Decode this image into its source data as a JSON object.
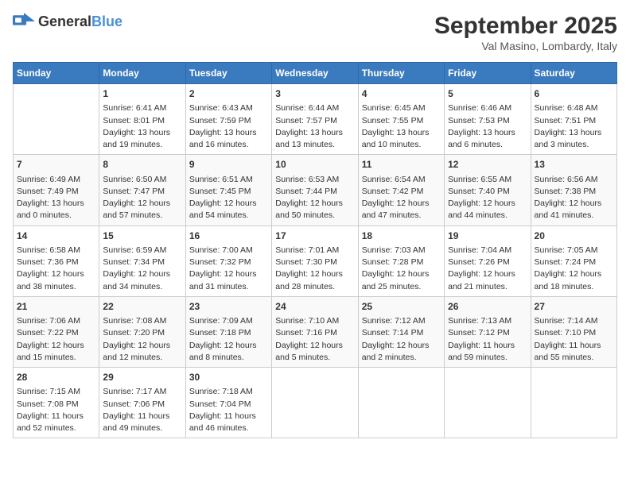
{
  "header": {
    "logo_general": "General",
    "logo_blue": "Blue",
    "title": "September 2025",
    "subtitle": "Val Masino, Lombardy, Italy"
  },
  "days_of_week": [
    "Sunday",
    "Monday",
    "Tuesday",
    "Wednesday",
    "Thursday",
    "Friday",
    "Saturday"
  ],
  "weeks": [
    [
      {
        "day": "",
        "info": ""
      },
      {
        "day": "1",
        "info": "Sunrise: 6:41 AM\nSunset: 8:01 PM\nDaylight: 13 hours\nand 19 minutes."
      },
      {
        "day": "2",
        "info": "Sunrise: 6:43 AM\nSunset: 7:59 PM\nDaylight: 13 hours\nand 16 minutes."
      },
      {
        "day": "3",
        "info": "Sunrise: 6:44 AM\nSunset: 7:57 PM\nDaylight: 13 hours\nand 13 minutes."
      },
      {
        "day": "4",
        "info": "Sunrise: 6:45 AM\nSunset: 7:55 PM\nDaylight: 13 hours\nand 10 minutes."
      },
      {
        "day": "5",
        "info": "Sunrise: 6:46 AM\nSunset: 7:53 PM\nDaylight: 13 hours\nand 6 minutes."
      },
      {
        "day": "6",
        "info": "Sunrise: 6:48 AM\nSunset: 7:51 PM\nDaylight: 13 hours\nand 3 minutes."
      }
    ],
    [
      {
        "day": "7",
        "info": "Sunrise: 6:49 AM\nSunset: 7:49 PM\nDaylight: 13 hours\nand 0 minutes."
      },
      {
        "day": "8",
        "info": "Sunrise: 6:50 AM\nSunset: 7:47 PM\nDaylight: 12 hours\nand 57 minutes."
      },
      {
        "day": "9",
        "info": "Sunrise: 6:51 AM\nSunset: 7:45 PM\nDaylight: 12 hours\nand 54 minutes."
      },
      {
        "day": "10",
        "info": "Sunrise: 6:53 AM\nSunset: 7:44 PM\nDaylight: 12 hours\nand 50 minutes."
      },
      {
        "day": "11",
        "info": "Sunrise: 6:54 AM\nSunset: 7:42 PM\nDaylight: 12 hours\nand 47 minutes."
      },
      {
        "day": "12",
        "info": "Sunrise: 6:55 AM\nSunset: 7:40 PM\nDaylight: 12 hours\nand 44 minutes."
      },
      {
        "day": "13",
        "info": "Sunrise: 6:56 AM\nSunset: 7:38 PM\nDaylight: 12 hours\nand 41 minutes."
      }
    ],
    [
      {
        "day": "14",
        "info": "Sunrise: 6:58 AM\nSunset: 7:36 PM\nDaylight: 12 hours\nand 38 minutes."
      },
      {
        "day": "15",
        "info": "Sunrise: 6:59 AM\nSunset: 7:34 PM\nDaylight: 12 hours\nand 34 minutes."
      },
      {
        "day": "16",
        "info": "Sunrise: 7:00 AM\nSunset: 7:32 PM\nDaylight: 12 hours\nand 31 minutes."
      },
      {
        "day": "17",
        "info": "Sunrise: 7:01 AM\nSunset: 7:30 PM\nDaylight: 12 hours\nand 28 minutes."
      },
      {
        "day": "18",
        "info": "Sunrise: 7:03 AM\nSunset: 7:28 PM\nDaylight: 12 hours\nand 25 minutes."
      },
      {
        "day": "19",
        "info": "Sunrise: 7:04 AM\nSunset: 7:26 PM\nDaylight: 12 hours\nand 21 minutes."
      },
      {
        "day": "20",
        "info": "Sunrise: 7:05 AM\nSunset: 7:24 PM\nDaylight: 12 hours\nand 18 minutes."
      }
    ],
    [
      {
        "day": "21",
        "info": "Sunrise: 7:06 AM\nSunset: 7:22 PM\nDaylight: 12 hours\nand 15 minutes."
      },
      {
        "day": "22",
        "info": "Sunrise: 7:08 AM\nSunset: 7:20 PM\nDaylight: 12 hours\nand 12 minutes."
      },
      {
        "day": "23",
        "info": "Sunrise: 7:09 AM\nSunset: 7:18 PM\nDaylight: 12 hours\nand 8 minutes."
      },
      {
        "day": "24",
        "info": "Sunrise: 7:10 AM\nSunset: 7:16 PM\nDaylight: 12 hours\nand 5 minutes."
      },
      {
        "day": "25",
        "info": "Sunrise: 7:12 AM\nSunset: 7:14 PM\nDaylight: 12 hours\nand 2 minutes."
      },
      {
        "day": "26",
        "info": "Sunrise: 7:13 AM\nSunset: 7:12 PM\nDaylight: 11 hours\nand 59 minutes."
      },
      {
        "day": "27",
        "info": "Sunrise: 7:14 AM\nSunset: 7:10 PM\nDaylight: 11 hours\nand 55 minutes."
      }
    ],
    [
      {
        "day": "28",
        "info": "Sunrise: 7:15 AM\nSunset: 7:08 PM\nDaylight: 11 hours\nand 52 minutes."
      },
      {
        "day": "29",
        "info": "Sunrise: 7:17 AM\nSunset: 7:06 PM\nDaylight: 11 hours\nand 49 minutes."
      },
      {
        "day": "30",
        "info": "Sunrise: 7:18 AM\nSunset: 7:04 PM\nDaylight: 11 hours\nand 46 minutes."
      },
      {
        "day": "",
        "info": ""
      },
      {
        "day": "",
        "info": ""
      },
      {
        "day": "",
        "info": ""
      },
      {
        "day": "",
        "info": ""
      }
    ]
  ]
}
